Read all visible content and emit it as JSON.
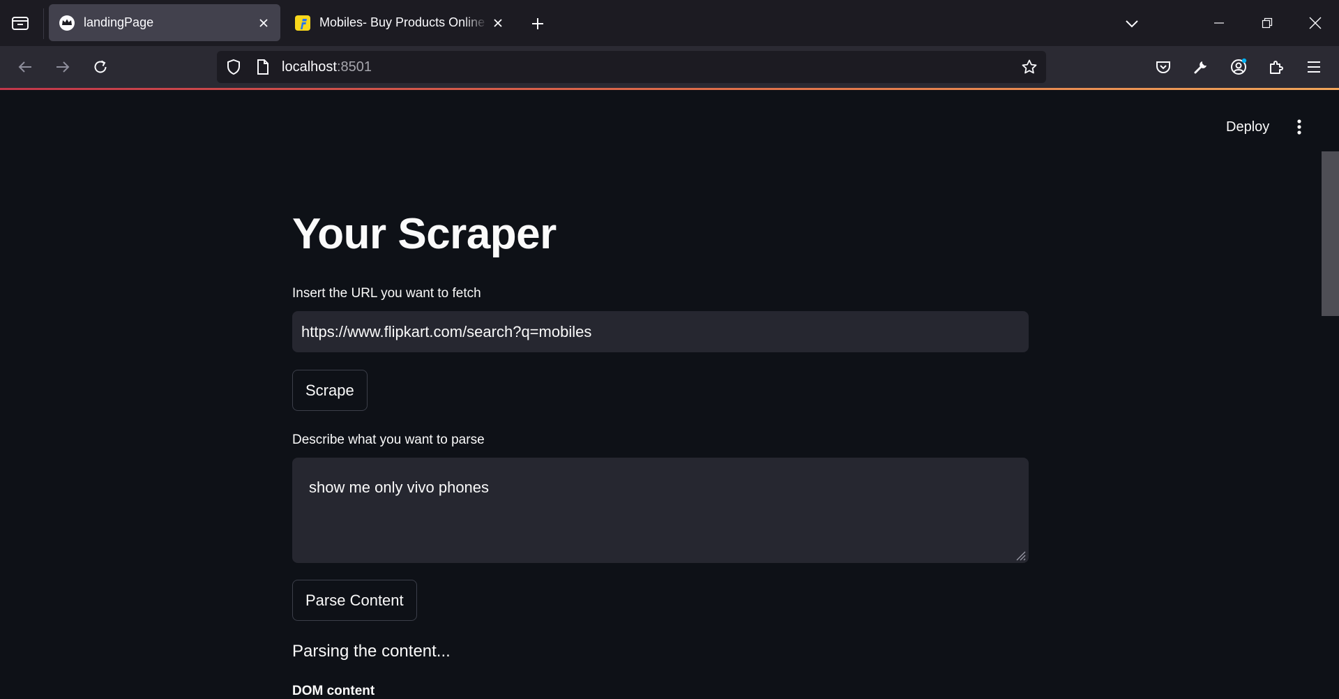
{
  "browser": {
    "tabs": [
      {
        "title": "landingPage",
        "active": true,
        "favicon": "streamlit-crown-icon"
      },
      {
        "title": "Mobiles- Buy Products Online at Best Price",
        "active": false,
        "favicon": "flipkart-icon"
      }
    ],
    "url": {
      "host": "localhost",
      "port": ":8501"
    }
  },
  "app": {
    "deploy_label": "Deploy",
    "title": "Your Scraper",
    "url_input": {
      "label": "Insert the URL you want to fetch",
      "value": "https://www.flipkart.com/search?q=mobiles"
    },
    "scrape_button": "Scrape",
    "parse_input": {
      "label": "Describe what you want to parse",
      "value": "show me only vivo phones"
    },
    "parse_button": "Parse Content",
    "status_text": "Parsing the content...",
    "dom_label": "DOM content"
  },
  "colors": {
    "background": "#0e1117",
    "input_bg": "#262730",
    "tabbar": "#1c1b22",
    "navbar": "#2b2a33",
    "active_tab": "#42414d"
  }
}
